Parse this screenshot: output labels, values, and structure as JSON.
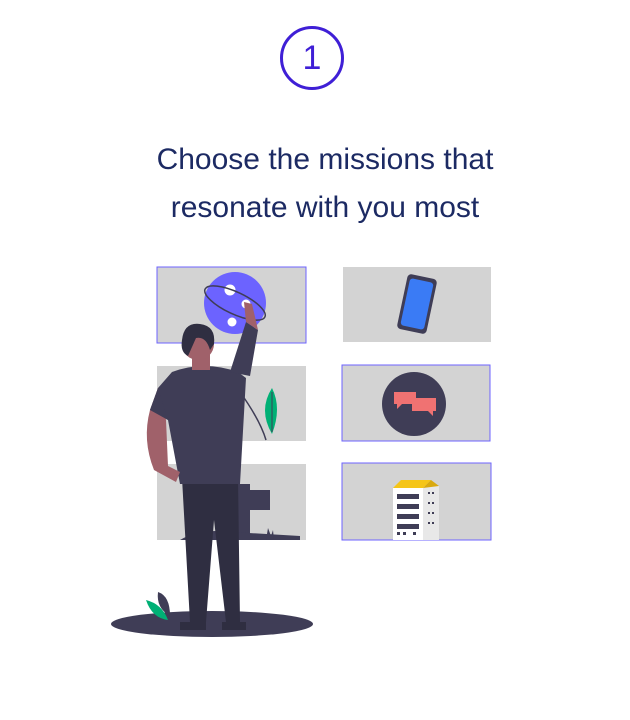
{
  "step": {
    "number": "1"
  },
  "heading": {
    "line1": "Choose the missions that",
    "line2": "resonate with you most"
  },
  "colors": {
    "accent": "#3f1fd6",
    "heading": "#1c2a63",
    "tile": "#d3d3d3",
    "tile_border": "#6c63ff",
    "figure_dark": "#3f3d56",
    "skin": "#a0616a",
    "leaf": "#00b075",
    "planet": "#6c63ff",
    "phone": "#3a7bf5",
    "chat": "#f07272",
    "building_roof": "#f5c518"
  },
  "tiles": [
    {
      "id": "tile-planet",
      "icon": "planet-icon",
      "selected": true
    },
    {
      "id": "tile-phone",
      "icon": "phone-icon",
      "selected": false
    },
    {
      "id": "tile-plant",
      "icon": "plant-icon",
      "selected": false
    },
    {
      "id": "tile-chat",
      "icon": "chat-bubbles-icon",
      "selected": true
    },
    {
      "id": "tile-city",
      "icon": "city-icon",
      "selected": false
    },
    {
      "id": "tile-building",
      "icon": "building-icon",
      "selected": true
    }
  ]
}
